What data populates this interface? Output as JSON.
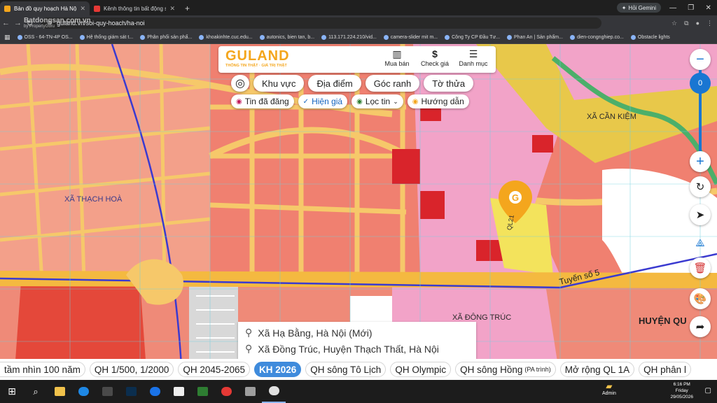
{
  "browser": {
    "tabs": [
      {
        "title": "Bản đồ quy hoạch Hà Nội, tra c",
        "active": true,
        "color": "#f4a61d"
      },
      {
        "title": "Kênh thông tin bất động sản -",
        "active": false,
        "color": "#e53935"
      }
    ],
    "newtab": "+",
    "gemini": "Hỏi Gemini",
    "url": "guland.vn/soi-quy-hoach/ha-noi",
    "watermark": "Batdongsan.com.vn",
    "watermark_sub": "by PropertyGuru",
    "bookmarks": [
      "OSS - 64-TN-4P OS...",
      "Hệ thống giám sát t...",
      "Phân phối sản phẩ...",
      "khoakinhte.cuc.edu...",
      "autonics, bien tan, b...",
      "113.171.224.210/vid...",
      "camera-slider mit m...",
      "Công Ty CP Đầu Tư...",
      "Phan An | Sản phẩm...",
      "dien-congnghiep.co...",
      "Obstacle lights"
    ]
  },
  "header": {
    "logo": "GULAND",
    "slogan": "THÔNG TIN THẬT · GIÁ TRỊ THẬT",
    "buttons": [
      {
        "label": "Mua bán",
        "icon": "building-icon"
      },
      {
        "label": "Check giá",
        "icon": "dollar-icon"
      },
      {
        "label": "Danh mục",
        "icon": "menu-icon"
      }
    ]
  },
  "filters": {
    "primary": [
      "Khu vực",
      "Địa điểm",
      "Góc ranh",
      "Tờ thửa"
    ],
    "secondary": [
      {
        "label": "Tin đã đăng",
        "icon": "pin-icon",
        "color": "#c2185b"
      },
      {
        "label": "Hiện giá",
        "icon": "check-circle-icon",
        "color": "#1565c0"
      },
      {
        "label": "Lọc tin",
        "icon": "filter-icon",
        "color": "#2e7d32"
      },
      {
        "label": "Hướng dẫn",
        "icon": "guide-icon",
        "color": "#f4a61d"
      }
    ]
  },
  "map_labels": {
    "xa_thach_hoa": "XÃ THẠCH HOÀ",
    "xa_can_kiem": "XÃ CẦN KIỆM",
    "xa_dong_truc": "XÃ ĐÔNG TRÚC",
    "huyen": "HUYỆN QU",
    "tuyen": "Tuyến số 5",
    "road_code": "QL21"
  },
  "zoom": {
    "level": "0",
    "plus": "+",
    "minus": "−"
  },
  "location": {
    "line1": "Xã Hạ Bằng, Hà Nội (Mới)",
    "line2": "Xã Đồng Trúc, Huyện Thạch Thất, Hà Nội"
  },
  "plans": [
    {
      "label": "tầm nhìn 100 năm",
      "active": false
    },
    {
      "label": "QH 1/500, 1/2000",
      "active": false
    },
    {
      "label": "QH 2045-2065",
      "active": false
    },
    {
      "label": "KH 2026",
      "active": true
    },
    {
      "label": "QH sông Tô Lịch",
      "active": false
    },
    {
      "label": "QH Olympic",
      "active": false
    },
    {
      "label": "QH sông Hồng",
      "note": "(PA trình)",
      "active": false
    },
    {
      "label": "Mở rộng QL 1A",
      "active": false
    },
    {
      "label": "QH phân l",
      "active": false
    }
  ],
  "taskbar": {
    "user": "Admin",
    "time": "6:16 PM",
    "day": "Friday",
    "date": "29/05/2026"
  }
}
